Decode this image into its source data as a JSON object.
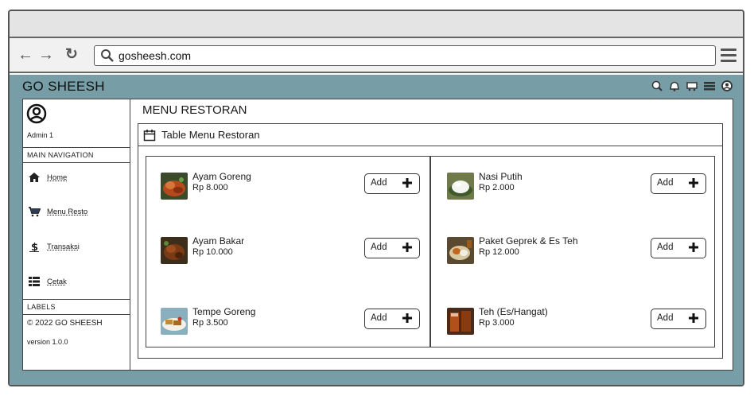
{
  "browser": {
    "url": "gosheesh.com",
    "back_icon": "arrow-left-icon",
    "forward_icon": "arrow-right-icon",
    "reload_icon": "reload-icon",
    "menu_icon": "hamburger-menu-icon"
  },
  "app": {
    "brand": "GO SHEESH",
    "accent_color": "#779da7",
    "header_icons": [
      "search-icon",
      "bell-icon",
      "cart-icon",
      "list-icon",
      "user-icon"
    ]
  },
  "sidebar": {
    "admin_name": "Admin 1",
    "main_navigation_label": "MAIN NAVIGATION",
    "items": [
      {
        "label": "Home",
        "icon": "home-icon"
      },
      {
        "label": "Menu Resto",
        "icon": "cart-icon"
      },
      {
        "label": "Transaksi",
        "icon": "dollar-icon"
      },
      {
        "label": "Cetak",
        "icon": "table-icon"
      }
    ],
    "labels_label": "LABELS",
    "copyright": "© 2022 GO SHEESH",
    "version": "version 1.0.0"
  },
  "main": {
    "page_title": "MENU RESTORAN",
    "panel_title": "Table Menu Restoran",
    "panel_icon": "calendar-icon",
    "add_label": "Add",
    "menu_items": [
      {
        "name": "Ayam Goreng",
        "price": "Rp 8.000"
      },
      {
        "name": "Nasi Putih",
        "price": "Rp 2.000"
      },
      {
        "name": "Ayam Bakar",
        "price": "Rp 10.000"
      },
      {
        "name": "Paket Geprek & Es Teh",
        "price": "Rp 12.000"
      },
      {
        "name": "Tempe Goreng",
        "price": "Rp 3.500"
      },
      {
        "name": "Teh (Es/Hangat)",
        "price": "Rp 3.000"
      }
    ]
  }
}
